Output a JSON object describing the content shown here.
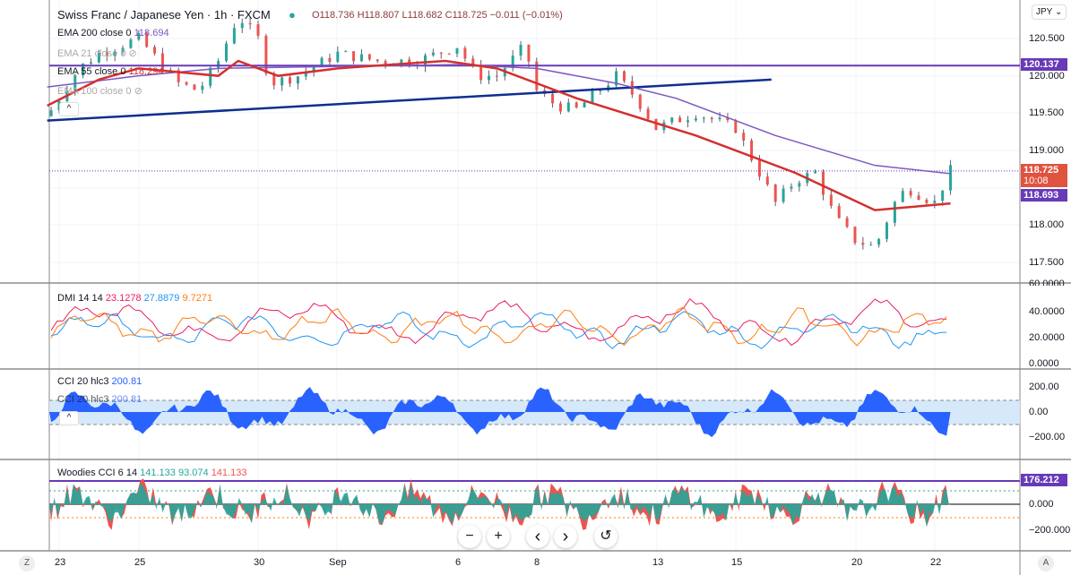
{
  "header": {
    "title": "Swiss Franc / Japanese Yen · 1h · FXCM",
    "open": "O118.736",
    "high": "H118.807",
    "low": "L118.682",
    "close": "C118.725",
    "change": "−0.011 (−0.01%)"
  },
  "legend": {
    "ema200": "EMA 200 close 0",
    "ema200_val": "118.694",
    "ema21": "EMA 21 close 0",
    "ema55": "EMA 55 close 0",
    "ema55_val": "118.294",
    "ema100": "EMA 100 close 0"
  },
  "currency_button": "JPY ⌄",
  "price_axis": [
    "120.500",
    "120.000",
    "119.500",
    "119.000",
    "118.000",
    "117.500"
  ],
  "price_tags": {
    "line": "120.137",
    "last": "118.725",
    "countdown": "10:08",
    "ema200": "118.693"
  },
  "dmi": {
    "label": "DMI 14 14",
    "v1": "23.1278",
    "v2": "27.8879",
    "v3": "9.7271",
    "axis": [
      "60.0000",
      "40.0000",
      "20.0000",
      "0.0000"
    ]
  },
  "cci": {
    "label": "CCI 20 hlc3",
    "value": "200.81",
    "axis": [
      "200.00",
      "0.00",
      "−200.00"
    ]
  },
  "woodies": {
    "label": "Woodies CCI 6 14",
    "v1": "141.133",
    "v2": "93.074",
    "v3": "141.133",
    "tag": "176.212",
    "axis": [
      "0.000",
      "−200.000"
    ]
  },
  "x_axis": [
    "23",
    "25",
    "30",
    "Sep",
    "6",
    "8",
    "13",
    "15",
    "20",
    "22"
  ],
  "controls": {
    "zoom_out": "−",
    "zoom_in": "+",
    "left": "‹",
    "right": "›",
    "reset": "↺",
    "z": "Z",
    "a": "A",
    "collapse": "^"
  },
  "colors": {
    "up": "#26a69a",
    "down": "#ef5350",
    "ema55": "#d32f2f",
    "ema200": "#7e57c2",
    "hline": "#673ab7",
    "trend": "#0d2f8f",
    "cci": "#2962ff",
    "dmi_plus": "#e91e63",
    "dmi_minus": "#2196f3",
    "adx": "#ff7f0e"
  },
  "chart_data": {
    "type": "line",
    "x_labels": [
      "23",
      "25",
      "30",
      "Sep",
      "6",
      "8",
      "13",
      "15",
      "20",
      "22"
    ],
    "price_close": [
      [
        0,
        119.7
      ],
      [
        0.5,
        120.1
      ],
      [
        1,
        120.3
      ],
      [
        2,
        120.5
      ],
      [
        2.5,
        120.2
      ],
      [
        3,
        119.9
      ],
      [
        3.5,
        119.8
      ],
      [
        4,
        120.2
      ],
      [
        4.5,
        120.8
      ],
      [
        5,
        120.5
      ],
      [
        5.3,
        119.9
      ],
      [
        6,
        120.0
      ],
      [
        7,
        120.3
      ],
      [
        8,
        120.2
      ],
      [
        9,
        120.2
      ],
      [
        10,
        120.4
      ],
      [
        10.5,
        120.0
      ],
      [
        11,
        120.0
      ],
      [
        11.7,
        120.4
      ],
      [
        12,
        119.8
      ],
      [
        12.5,
        119.6
      ],
      [
        13,
        119.55
      ],
      [
        14,
        120.0
      ],
      [
        14.5,
        119.7
      ],
      [
        15,
        119.3
      ],
      [
        16,
        119.5
      ],
      [
        17,
        119.3
      ],
      [
        17.5,
        118.8
      ],
      [
        18,
        118.3
      ],
      [
        18.5,
        118.6
      ],
      [
        19,
        118.7
      ],
      [
        19.5,
        118.1
      ],
      [
        20,
        117.8
      ],
      [
        20.5,
        117.7
      ],
      [
        21,
        118.3
      ],
      [
        21.3,
        118.5
      ],
      [
        22,
        118.3
      ],
      [
        22.4,
        118.73
      ]
    ],
    "ema55": [
      [
        -0.3,
        119.6
      ],
      [
        1,
        119.95
      ],
      [
        2,
        120.1
      ],
      [
        4,
        120.0
      ],
      [
        4.5,
        120.2
      ],
      [
        5.5,
        120.0
      ],
      [
        7,
        120.1
      ],
      [
        9.7,
        120.2
      ],
      [
        11,
        120.1
      ],
      [
        13,
        119.7
      ],
      [
        16,
        119.2
      ],
      [
        18.5,
        118.7
      ],
      [
        20.5,
        118.2
      ],
      [
        22.4,
        118.29
      ]
    ],
    "ema200": [
      [
        -0.3,
        119.85
      ],
      [
        2,
        120.0
      ],
      [
        4,
        120.1
      ],
      [
        10,
        120.15
      ],
      [
        12,
        120.1
      ],
      [
        14,
        119.9
      ],
      [
        15.5,
        119.7
      ],
      [
        18,
        119.2
      ],
      [
        20.5,
        118.8
      ],
      [
        22.4,
        118.69
      ]
    ],
    "hline": 120.137,
    "trendline": [
      [
        -0.3,
        119.4
      ],
      [
        17.9,
        119.95
      ]
    ],
    "ylim": [
      117.3,
      120.85
    ]
  }
}
